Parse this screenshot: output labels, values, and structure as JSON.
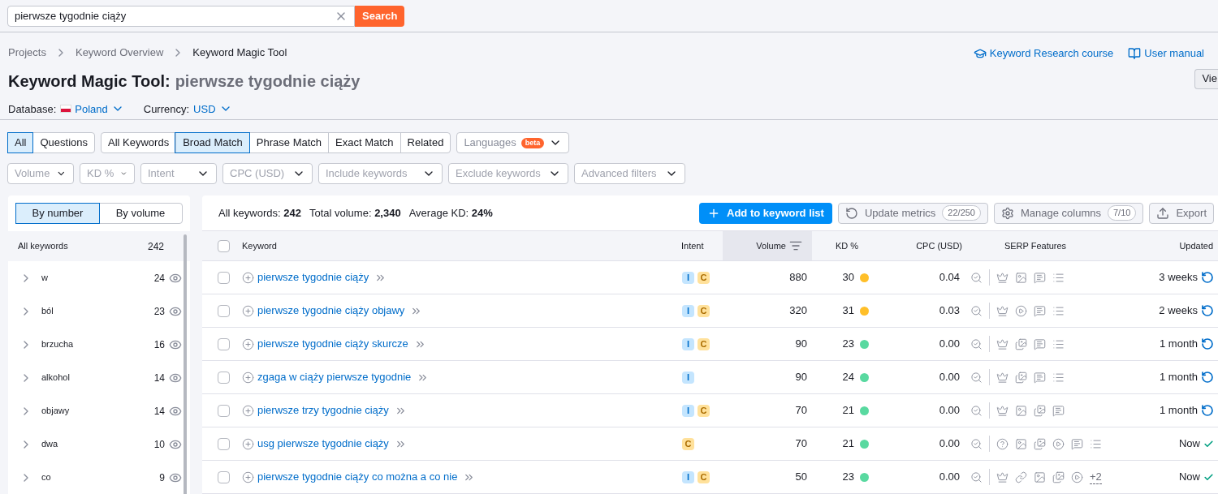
{
  "search": {
    "value": "pierwsze tygodnie ciąży",
    "button": "Search"
  },
  "breadcrumbs": [
    "Projects",
    "Keyword Overview",
    "Keyword Magic Tool"
  ],
  "title": {
    "tool": "Keyword Magic Tool:",
    "query": "pierwsze tygodnie ciąży"
  },
  "links": [
    {
      "kind": "course",
      "label": "Keyword Research course"
    },
    {
      "kind": "manual",
      "label": "User manual"
    }
  ],
  "view_button": "Vie",
  "database": {
    "label": "Database:",
    "value": "Poland"
  },
  "currency": {
    "label": "Currency:",
    "value": "USD"
  },
  "type_tabs": [
    {
      "label": "All",
      "selected": true
    },
    {
      "label": "Questions",
      "selected": false
    }
  ],
  "match_tabs": [
    {
      "label": "All Keywords",
      "selected": false
    },
    {
      "label": "Broad Match",
      "selected": true
    },
    {
      "label": "Phrase Match",
      "selected": false
    },
    {
      "label": "Exact Match",
      "selected": false
    },
    {
      "label": "Related",
      "selected": false
    }
  ],
  "languages": {
    "label": "Languages",
    "badge": "beta"
  },
  "filters": [
    "Volume",
    "KD %",
    "Intent",
    "CPC (USD)",
    "Include keywords",
    "Exclude keywords",
    "Advanced filters"
  ],
  "group_tabs": [
    {
      "label": "By number",
      "selected": true
    },
    {
      "label": "By volume",
      "selected": false
    }
  ],
  "groups_header": {
    "label": "All keywords",
    "count": "242"
  },
  "groups": [
    {
      "label": "w",
      "count": "24"
    },
    {
      "label": "ból",
      "count": "23"
    },
    {
      "label": "brzucha",
      "count": "16"
    },
    {
      "label": "alkohol",
      "count": "14"
    },
    {
      "label": "objawy",
      "count": "14"
    },
    {
      "label": "dwa",
      "count": "10"
    },
    {
      "label": "co",
      "count": "9"
    }
  ],
  "summary": [
    {
      "label": "All keywords:",
      "value": "242"
    },
    {
      "label": "Total volume:",
      "value": "2,340"
    },
    {
      "label": "Average KD:",
      "value": "24%"
    }
  ],
  "actions": {
    "add": "Add to keyword list",
    "update": {
      "label": "Update metrics",
      "count": "22/250"
    },
    "columns": {
      "label": "Manage columns",
      "count": "7/10"
    },
    "export": "Export"
  },
  "table": {
    "select_all": {
      "checked": false
    },
    "columns": [
      "Keyword",
      "Intent",
      "Volume",
      "KD %",
      "CPC (USD)",
      "SERP Features",
      "Updated"
    ],
    "rows": [
      {
        "keyword": "pierwsze tygodnie ciąży",
        "intent": [
          {
            "text": "I",
            "kind": "informational"
          },
          {
            "text": "C",
            "kind": "commercial"
          }
        ],
        "volume": "880",
        "kd": "30",
        "color": "#ffbf29",
        "cpc": "0.04",
        "serp": [
          {
            "kind": "crown"
          },
          {
            "kind": "image"
          },
          {
            "kind": "faq"
          },
          {
            "kind": "list"
          }
        ],
        "checked": false,
        "updated": {
          "text": "3 weeks",
          "kind": "refresh"
        }
      },
      {
        "keyword": "pierwsze tygodnie ciąży objawy",
        "intent": [
          {
            "text": "I",
            "kind": "informational"
          },
          {
            "text": "C",
            "kind": "commercial"
          }
        ],
        "volume": "320",
        "kd": "31",
        "color": "#ffbf29",
        "cpc": "0.03",
        "serp": [
          {
            "kind": "crown"
          },
          {
            "kind": "video"
          },
          {
            "kind": "faq"
          },
          {
            "kind": "list"
          }
        ],
        "checked": false,
        "updated": {
          "text": "2 weeks",
          "kind": "refresh"
        }
      },
      {
        "keyword": "pierwsze tygodnie ciąży skurcze",
        "intent": [
          {
            "text": "I",
            "kind": "informational"
          },
          {
            "text": "C",
            "kind": "commercial"
          }
        ],
        "volume": "90",
        "kd": "23",
        "color": "#59d9a0",
        "cpc": "0.00",
        "serp": [
          {
            "kind": "crown"
          },
          {
            "kind": "images"
          },
          {
            "kind": "faq"
          },
          {
            "kind": "list"
          }
        ],
        "checked": false,
        "updated": {
          "text": "1 month",
          "kind": "refresh"
        }
      },
      {
        "keyword": "zgaga w ciąży pierwsze tygodnie",
        "intent": [
          {
            "text": "I",
            "kind": "informational"
          }
        ],
        "volume": "90",
        "kd": "24",
        "color": "#59d9a0",
        "cpc": "0.00",
        "serp": [
          {
            "kind": "crown"
          },
          {
            "kind": "images"
          },
          {
            "kind": "faq"
          },
          {
            "kind": "list"
          }
        ],
        "checked": false,
        "updated": {
          "text": "1 month",
          "kind": "refresh"
        }
      },
      {
        "keyword": "pierwsze trzy tygodnie ciąży",
        "intent": [
          {
            "text": "I",
            "kind": "informational"
          },
          {
            "text": "C",
            "kind": "commercial"
          }
        ],
        "volume": "70",
        "kd": "21",
        "color": "#59d9a0",
        "cpc": "0.00",
        "serp": [
          {
            "kind": "crown"
          },
          {
            "kind": "image"
          },
          {
            "kind": "images"
          },
          {
            "kind": "faq"
          }
        ],
        "checked": false,
        "updated": {
          "text": "1 month",
          "kind": "refresh"
        }
      },
      {
        "keyword": "usg pierwsze tygodnie ciąży",
        "intent": [
          {
            "text": "C",
            "kind": "commercial"
          }
        ],
        "volume": "70",
        "kd": "21",
        "color": "#59d9a0",
        "cpc": "0.00",
        "serp": [
          {
            "kind": "question"
          },
          {
            "kind": "image"
          },
          {
            "kind": "images"
          },
          {
            "kind": "video"
          },
          {
            "kind": "faq"
          },
          {
            "kind": "list"
          }
        ],
        "checked": false,
        "updated": {
          "text": "Now",
          "kind": "done"
        }
      },
      {
        "keyword": "pierwsze tygodnie ciąży co można a co nie",
        "intent": [
          {
            "text": "I",
            "kind": "informational"
          },
          {
            "text": "C",
            "kind": "commercial"
          }
        ],
        "volume": "50",
        "kd": "23",
        "color": "#59d9a0",
        "cpc": "0.00",
        "serp": [
          {
            "kind": "crown"
          },
          {
            "kind": "link"
          },
          {
            "kind": "image"
          },
          {
            "kind": "images"
          },
          {
            "kind": "video"
          },
          {
            "kind": "more",
            "text": "+2"
          }
        ],
        "checked": false,
        "updated": {
          "text": "Now",
          "kind": "done"
        }
      }
    ]
  }
}
